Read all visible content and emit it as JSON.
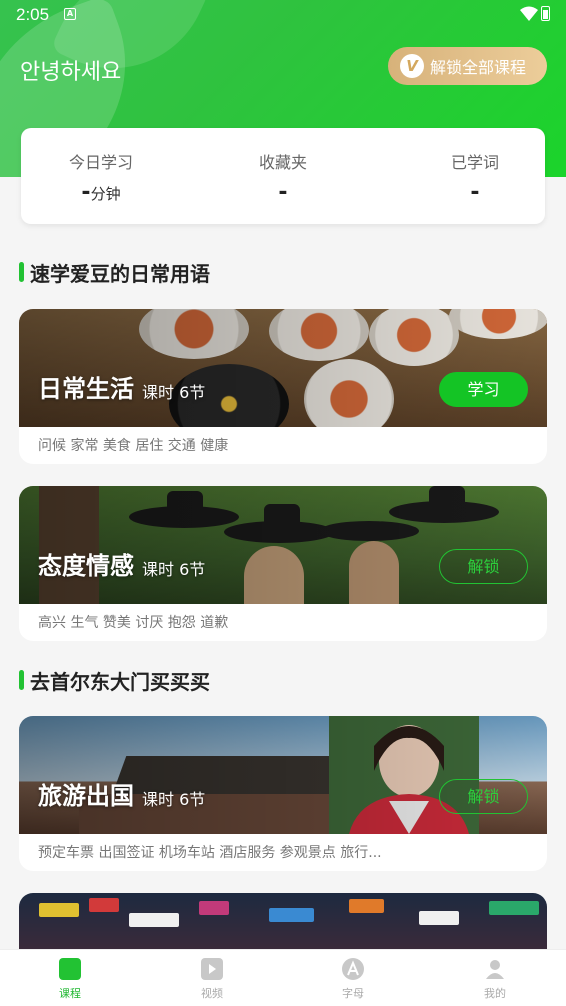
{
  "status_bar": {
    "time": "2:05",
    "sim": "A"
  },
  "header": {
    "greeting": "안녕하세요",
    "unlock_all_label": "解锁全部课程",
    "vip_glyph": "V"
  },
  "stats": [
    {
      "label": "今日学习",
      "value": "-",
      "unit": "分钟"
    },
    {
      "label": "收藏夹",
      "value": "-"
    },
    {
      "label": "已学词",
      "value": "-"
    }
  ],
  "sections": [
    {
      "title": "速学爱豆的日常用语"
    },
    {
      "title": "去首尔东大门买买买"
    }
  ],
  "courses": [
    {
      "title": "日常生活",
      "lessons": "课时 6节",
      "button": "学习",
      "tags": "问候 家常 美食 居住 交通 健康"
    },
    {
      "title": "态度情感",
      "lessons": "课时 6节",
      "button": "解锁",
      "tags": "高兴 生气 赞美 讨厌 抱怨 道歉"
    },
    {
      "title": "旅游出国",
      "lessons": "课时 6节",
      "button": "解锁",
      "tags": "预定车票 出国签证 机场车站 酒店服务 参观景点 旅行..."
    }
  ],
  "tabs": [
    {
      "label": "课程",
      "icon": "book-icon",
      "active": true
    },
    {
      "label": "视频",
      "icon": "video-play-icon",
      "active": false
    },
    {
      "label": "字母",
      "icon": "alphabet-icon",
      "active": false
    },
    {
      "label": "我的",
      "icon": "person-icon",
      "active": false
    }
  ],
  "colors": {
    "brand_green": "#22c233",
    "gold": "#d7b27a"
  }
}
